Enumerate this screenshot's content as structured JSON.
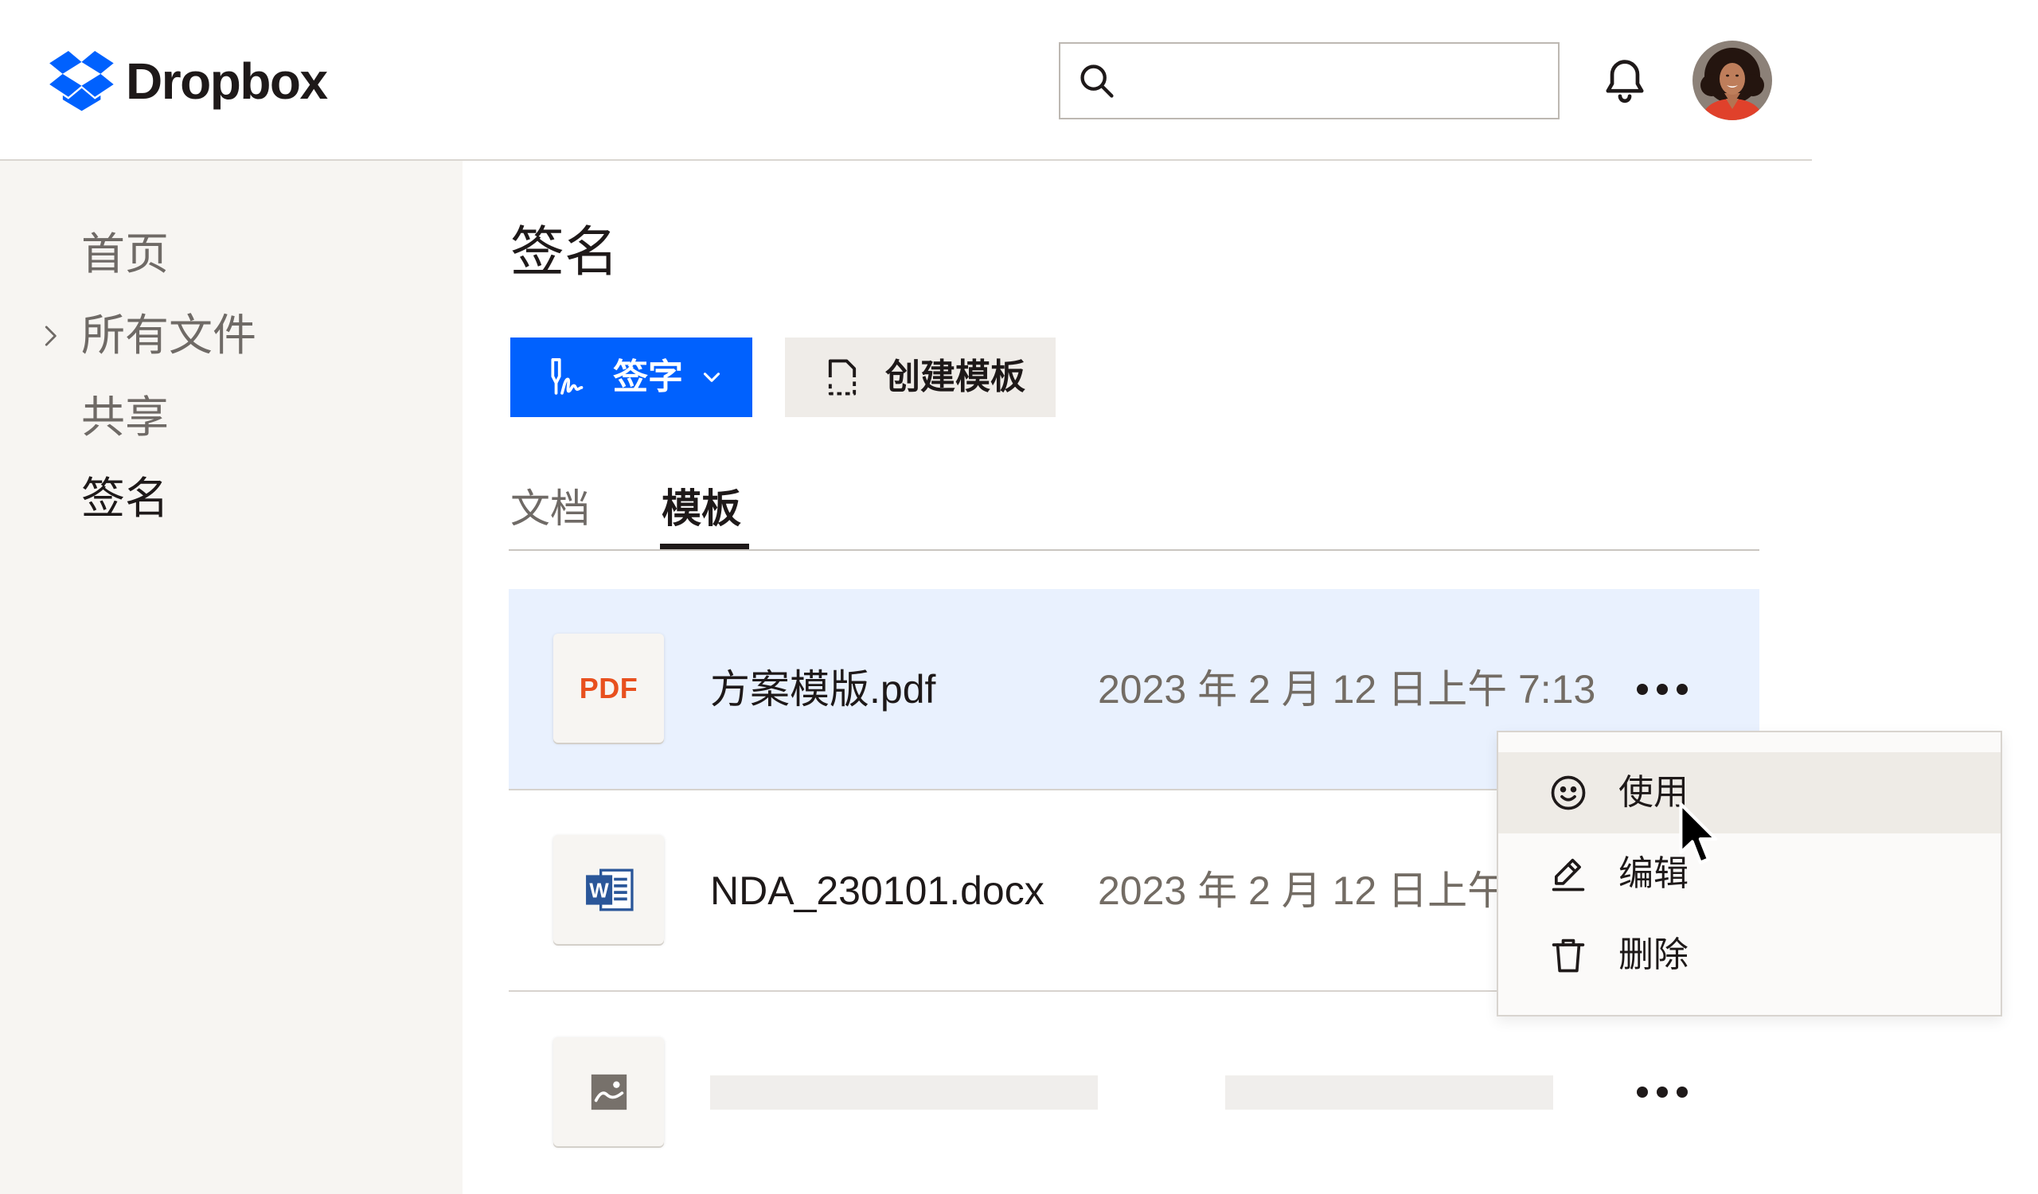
{
  "app": {
    "brand": "Dropbox",
    "logo_icon": "dropbox-logo-icon"
  },
  "colors": {
    "accent": "#0061FE",
    "pdf": "#E8501E",
    "word": "#2A5699",
    "row_highlight": "#E9F1FE",
    "sidebar_bg": "#F7F5F2",
    "menu_hover": "#EEEBE6"
  },
  "header": {
    "search": {
      "icon": "search-icon"
    },
    "notifications": {
      "icon": "bell-icon"
    },
    "account": {
      "icon": "avatar"
    }
  },
  "sidebar": {
    "items": [
      {
        "label": "首页",
        "selected": false
      },
      {
        "label": "所有文件",
        "selected": false,
        "expandable": true,
        "icon": "chevron-right-icon"
      },
      {
        "label": "共享",
        "selected": false
      },
      {
        "label": "签名",
        "selected": true
      }
    ]
  },
  "main": {
    "title": "签名",
    "toolbar": {
      "sign": {
        "label": "签字",
        "icon": "signature-icon",
        "dropdown_icon": "chevron-down-icon"
      },
      "create_template": {
        "label": "创建模板",
        "icon": "template-doc-icon"
      }
    },
    "tabs": [
      {
        "label": "文档",
        "active": false
      },
      {
        "label": "模板",
        "active": true
      }
    ],
    "rows": [
      {
        "icon": "pdf-file-icon",
        "icon_label": "PDF",
        "name": "方案模版.pdf",
        "date": "2023 年 2 月 12 日上午 7:13",
        "highlighted": true
      },
      {
        "icon": "word-file-icon",
        "icon_label": "W",
        "name": "NDA_230101.docx",
        "date": "2023 年 2 月 12 日上午",
        "highlighted": false
      },
      {
        "icon": "image-file-icon",
        "loading": true
      }
    ]
  },
  "context_menu": {
    "items": [
      {
        "label": "使用",
        "icon": "smiley-icon",
        "hovered": true
      },
      {
        "label": "编辑",
        "icon": "pencil-icon",
        "hovered": false
      },
      {
        "label": "删除",
        "icon": "trash-icon",
        "hovered": false
      }
    ]
  }
}
